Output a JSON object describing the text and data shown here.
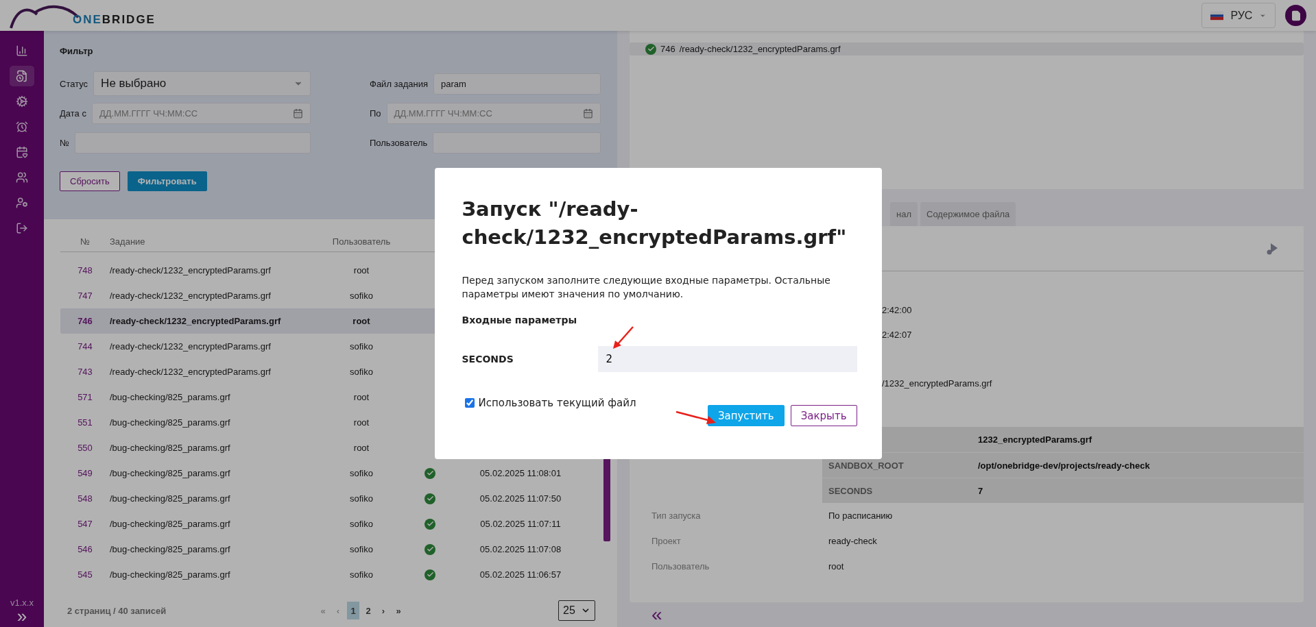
{
  "header": {
    "logo": {
      "accent": "ONE",
      "rest": "BRIDGE"
    },
    "language": "РУС"
  },
  "sidebar": {
    "items": [
      {
        "kind": "chart",
        "selected": false
      },
      {
        "kind": "document",
        "selected": true
      },
      {
        "kind": "gear",
        "selected": false
      },
      {
        "kind": "alarm",
        "selected": false
      },
      {
        "kind": "calendar",
        "selected": false
      },
      {
        "kind": "users",
        "selected": false
      },
      {
        "kind": "user-settings",
        "selected": false
      },
      {
        "kind": "logout",
        "selected": false
      }
    ],
    "version": "v1.x.x",
    "expand": "»"
  },
  "filter": {
    "title": "Фильтр",
    "fields": [
      {
        "label": "Статус",
        "kind": "select",
        "value": "Не выбрано"
      },
      {
        "label": "Файл задания",
        "kind": "text",
        "value": "param"
      },
      {
        "label": "Дата с",
        "kind": "date",
        "placeholder": "ДД.ММ.ГГГГ ЧЧ:ММ:СС"
      },
      {
        "label": "По",
        "kind": "date",
        "placeholder": "ДД.ММ.ГГГГ ЧЧ:ММ:СС"
      },
      {
        "label": "№",
        "kind": "text"
      },
      {
        "label": "Пользователь",
        "kind": "text"
      }
    ],
    "buttons": [
      {
        "label": "Сбросить",
        "kind": "secondary"
      },
      {
        "label": "Фильтровать",
        "kind": "primary"
      }
    ]
  },
  "tasks": {
    "columns": [
      "№",
      "Задание",
      "Пользователь"
    ],
    "rows": [
      {
        "number": "748",
        "task": "/ready-check/1232_encryptedParams.grf",
        "user": "root",
        "selected": false
      },
      {
        "number": "747",
        "task": "/ready-check/1232_encryptedParams.grf",
        "user": "sofiko",
        "selected": false
      },
      {
        "number": "746",
        "task": "/ready-check/1232_encryptedParams.grf",
        "user": "root",
        "selected": true
      },
      {
        "number": "744",
        "task": "/ready-check/1232_encryptedParams.grf",
        "user": "sofiko",
        "selected": false
      },
      {
        "number": "743",
        "task": "/ready-check/1232_encryptedParams.grf",
        "user": "sofiko",
        "selected": false
      },
      {
        "number": "571",
        "task": "/bug-checking/825_params.grf",
        "user": "root",
        "selected": false
      },
      {
        "number": "551",
        "task": "/bug-checking/825_params.grf",
        "user": "root",
        "selected": false
      },
      {
        "number": "550",
        "task": "/bug-checking/825_params.grf",
        "user": "root",
        "selected": false
      },
      {
        "number": "549",
        "task": "/bug-checking/825_params.grf",
        "user": "sofiko",
        "selected": false,
        "success": true,
        "date": "05.02.2025 11:08:01"
      },
      {
        "number": "548",
        "task": "/bug-checking/825_params.grf",
        "user": "sofiko",
        "selected": false,
        "success": true,
        "date": "05.02.2025 11:07:50"
      },
      {
        "number": "547",
        "task": "/bug-checking/825_params.grf",
        "user": "sofiko",
        "selected": false,
        "success": true,
        "date": "05.02.2025 11:07:11"
      },
      {
        "number": "546",
        "task": "/bug-checking/825_params.grf",
        "user": "sofiko",
        "selected": false,
        "success": true,
        "date": "05.02.2025 11:07:08"
      },
      {
        "number": "545",
        "task": "/bug-checking/825_params.grf",
        "user": "sofiko",
        "selected": false,
        "success": true,
        "date": "05.02.2025 11:06:57"
      }
    ],
    "pagination": {
      "summary": "2 страниц / 40 записей",
      "first": "«",
      "prev": "‹",
      "pages": [
        {
          "label": "1",
          "selected": true
        },
        {
          "label": "2",
          "selected": false
        }
      ],
      "next": "›",
      "last": "»",
      "page_size": "25"
    }
  },
  "details": {
    "selected_task": {
      "success": true,
      "number": "746",
      "path": "/ready-check/1232_encryptedParams.grf"
    },
    "tabs": [
      {
        "label": "нал",
        "selected": false
      },
      {
        "label": "Содержимое файла",
        "selected": false
      }
    ],
    "partial_rows": [
      {
        "value": "2:42:00"
      },
      {
        "value": "2:42:07"
      },
      {
        "value": "/1232_encryptedParams.grf"
      }
    ],
    "params": [
      {
        "value": "1232_encryptedParams.grf"
      },
      {
        "name": "SANDBOX_ROOT",
        "value": "/opt/onebridge-dev/projects/ready-check"
      },
      {
        "name": "SECONDS",
        "value": "7"
      }
    ],
    "info": [
      {
        "label": "Тип запуска",
        "value": "По расписанию"
      },
      {
        "label": "Проект",
        "value": "ready-check"
      },
      {
        "label": "Пользователь",
        "value": "root"
      }
    ],
    "collapse": "«"
  },
  "modal": {
    "title": "Запуск \"/ready-check/1232_encryptedParams.grf\"",
    "description": "Перед запуском заполните следующие входные параметры. Остальные параметры имеют значения по умолчанию.",
    "section": "Входные параметры",
    "params": [
      {
        "name": "SECONDS",
        "value": "2"
      }
    ],
    "use_current_file": {
      "label": "Использовать текущий файл",
      "checked": true
    },
    "buttons": [
      {
        "label": "Запустить",
        "kind": "primary"
      },
      {
        "label": "Закрыть",
        "kind": "secondary"
      }
    ]
  }
}
